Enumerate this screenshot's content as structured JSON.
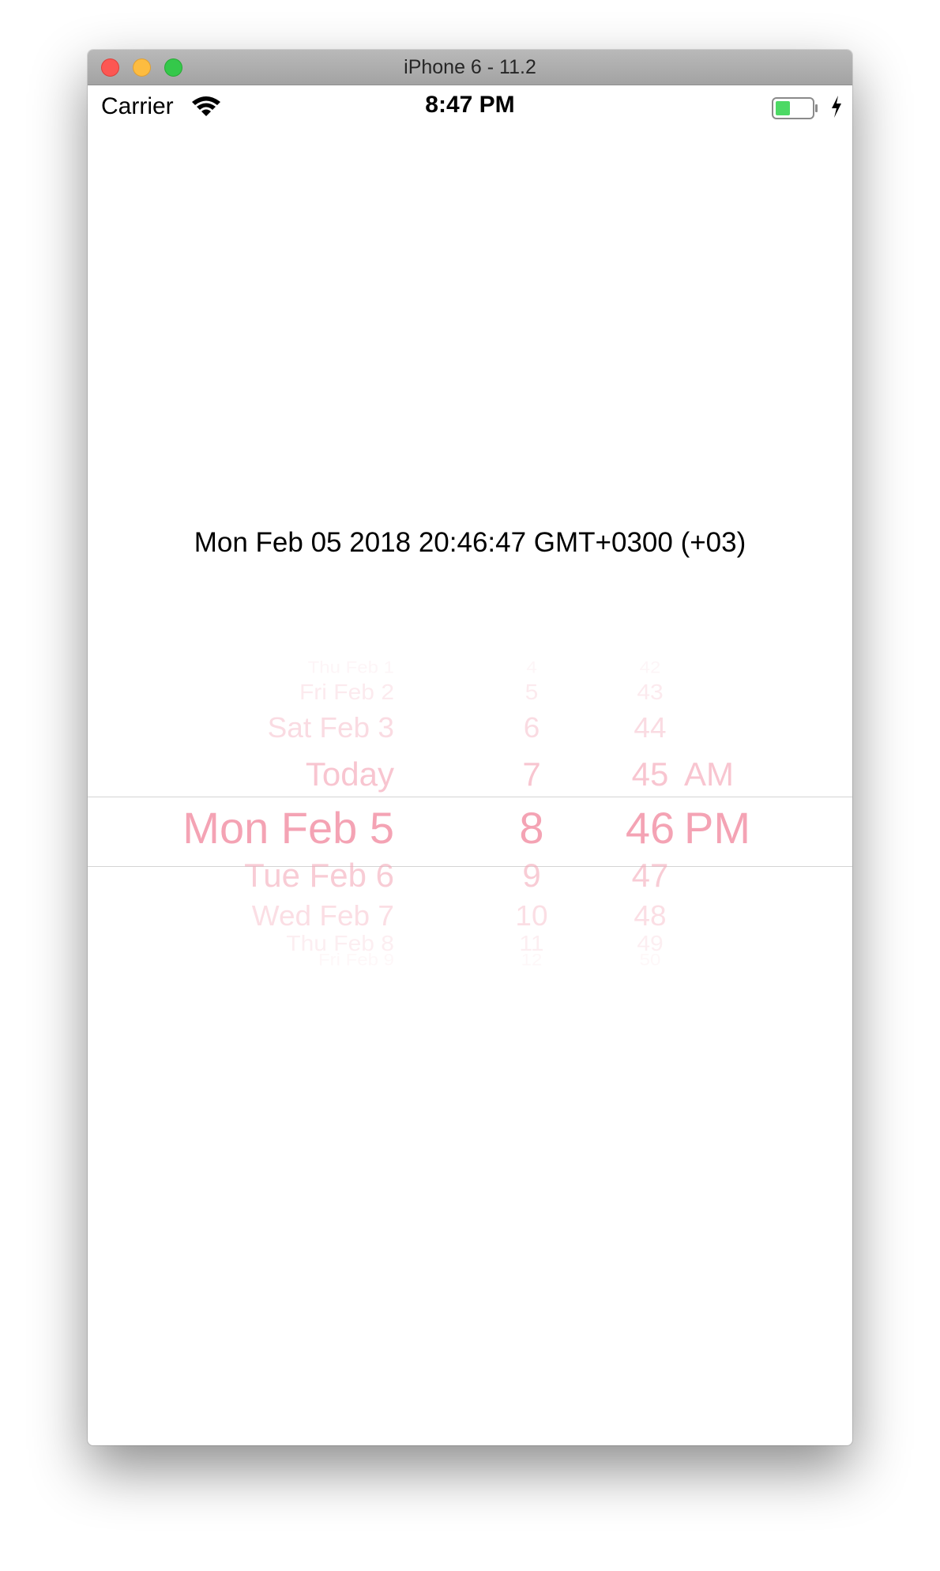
{
  "window": {
    "title": "iPhone 6 - 11.2"
  },
  "status_bar": {
    "carrier": "Carrier",
    "time": "8:47 PM",
    "battery_color": "#4cd964"
  },
  "main": {
    "date_text": "Mon Feb 05 2018 20:46:47 GMT+0300 (+03)"
  },
  "picker": {
    "accent_color": "#f4a3b4",
    "rows": [
      {
        "day": "Thu Feb 1",
        "hour": "4",
        "minute": "42",
        "ampm": ""
      },
      {
        "day": "Fri Feb 2",
        "hour": "5",
        "minute": "43",
        "ampm": ""
      },
      {
        "day": "Sat Feb 3",
        "hour": "6",
        "minute": "44",
        "ampm": ""
      },
      {
        "day": "Today",
        "hour": "7",
        "minute": "45",
        "ampm": "AM"
      },
      {
        "day": "Mon Feb 5",
        "hour": "8",
        "minute": "46",
        "ampm": "PM"
      },
      {
        "day": "Tue Feb 6",
        "hour": "9",
        "minute": "47",
        "ampm": ""
      },
      {
        "day": "Wed Feb 7",
        "hour": "10",
        "minute": "48",
        "ampm": ""
      },
      {
        "day": "Thu Feb 8",
        "hour": "11",
        "minute": "49",
        "ampm": ""
      },
      {
        "day": "Fri Feb 9",
        "hour": "12",
        "minute": "50",
        "ampm": ""
      }
    ],
    "selected": {
      "day": "Mon Feb 5",
      "hour": "8",
      "minute": "46",
      "ampm": "PM"
    }
  }
}
